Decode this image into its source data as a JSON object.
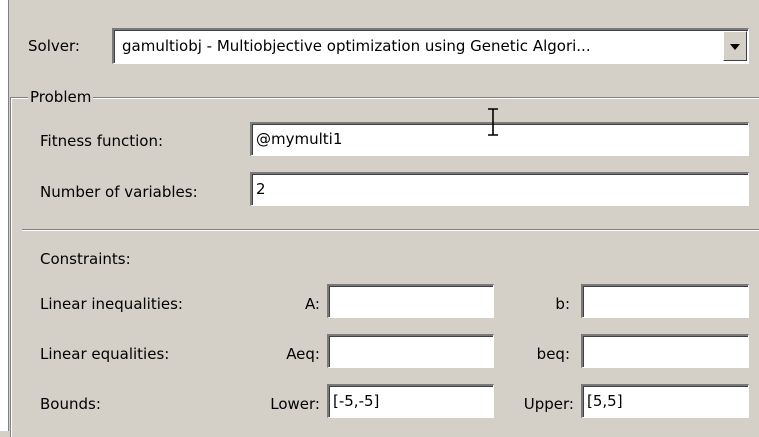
{
  "solver": {
    "label": "Solver:",
    "value": "gamultiobj - Multiobjective optimization using Genetic Algori..."
  },
  "problem": {
    "group_title": "Problem",
    "fitness_label": "Fitness function:",
    "fitness_value": "@mymulti1",
    "numvars_label": "Number of variables:",
    "numvars_value": "2"
  },
  "constraints": {
    "heading": "Constraints:",
    "linear_ineq_label": "Linear inequalities:",
    "A_label": "A:",
    "A_value": "",
    "b_label": "b:",
    "b_value": "",
    "linear_eq_label": "Linear equalities:",
    "Aeq_label": "Aeq:",
    "Aeq_value": "",
    "beq_label": "beq:",
    "beq_value": "",
    "bounds_label": "Bounds:",
    "lower_label": "Lower:",
    "lower_value": "[-5,-5]",
    "upper_label": "Upper:",
    "upper_value": "[5,5]"
  },
  "icons": {
    "dropdown": "chevron-down-icon",
    "cursor": "text-cursor-icon"
  }
}
